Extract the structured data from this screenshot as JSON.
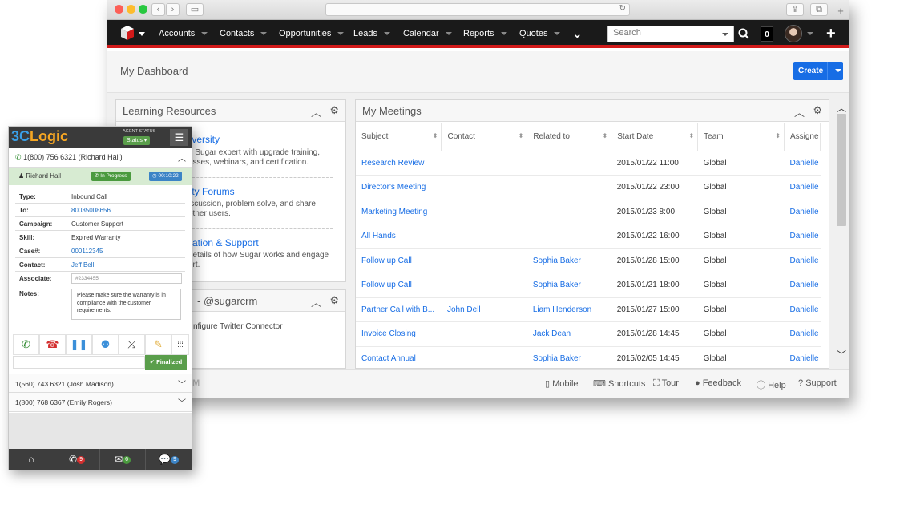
{
  "browser": {
    "controls": {
      "back": "‹",
      "forward": "›",
      "sidebar": "▭",
      "reload": "↻",
      "share": "⇪",
      "tabs": "⧉",
      "new_tab": "+"
    }
  },
  "nav": {
    "items": [
      "Accounts",
      "Contacts",
      "Opportunities",
      "Leads",
      "Calendar",
      "Reports",
      "Quotes"
    ],
    "more": "⌄",
    "search_placeholder": "Search",
    "notification_count": "0",
    "add": "+",
    "accent": "#d21a1a"
  },
  "dashboard": {
    "title": "My Dashboard",
    "create_label": "Create"
  },
  "learning": {
    "title": "Learning Resources",
    "items": [
      {
        "title": "niversity",
        "desc1": "n Sugar expert with upgrade training,",
        "desc2": "asses, webinars, and certification."
      },
      {
        "title": "nity Forums",
        "desc1": "iscussion, problem solve, and share",
        "desc2": "other users."
      },
      {
        "title": "ntation & Support",
        "desc1": "details of how Sugar works and engage",
        "desc2": "ort."
      }
    ]
  },
  "twitter": {
    "title": "- @sugarcrm",
    "text": "nfigure Twitter Connector"
  },
  "meetings": {
    "title": "My Meetings",
    "columns": [
      "Subject",
      "Contact",
      "Related to",
      "Start Date",
      "Team",
      "Assigne"
    ],
    "rows": [
      {
        "subject": "Research Review",
        "contact": "",
        "related": "",
        "start": "2015/01/22 11:00",
        "team": "Global",
        "assigned": "Danielle"
      },
      {
        "subject": "Director's Meeting",
        "contact": "",
        "related": "",
        "start": "2015/01/22 23:00",
        "team": "Global",
        "assigned": "Danielle"
      },
      {
        "subject": "Marketing Meeting",
        "contact": "",
        "related": "",
        "start": "2015/01/23 8:00",
        "team": "Global",
        "assigned": "Danielle"
      },
      {
        "subject": "All Hands",
        "contact": "",
        "related": "",
        "start": "2015/01/22 16:00",
        "team": "Global",
        "assigned": "Danielle"
      },
      {
        "subject": "Follow up Call",
        "contact": "",
        "related": "Sophia Baker",
        "start": "2015/01/28 15:00",
        "team": "Global",
        "assigned": "Danielle"
      },
      {
        "subject": "Follow up Call",
        "contact": "",
        "related": "Sophia Baker",
        "start": "2015/01/21 18:00",
        "team": "Global",
        "assigned": "Danielle"
      },
      {
        "subject": "Partner Call with B...",
        "contact": "John Dell",
        "related": "Liam Henderson",
        "start": "2015/01/27 15:00",
        "team": "Global",
        "assigned": "Danielle"
      },
      {
        "subject": "Invoice Closing",
        "contact": "",
        "related": "Jack Dean",
        "start": "2015/01/28 14:45",
        "team": "Global",
        "assigned": "Danielle"
      },
      {
        "subject": "Contact Annual",
        "contact": "",
        "related": "Sophia Baker",
        "start": "2015/02/05 14:45",
        "team": "Global",
        "assigned": "Danielle"
      }
    ]
  },
  "footer": {
    "brand": "M",
    "links": [
      "Mobile",
      "Shortcuts",
      "Tour",
      "Feedback",
      "Help",
      "Support"
    ]
  },
  "widget": {
    "logo_prefix": "3C",
    "logo_suffix": "Logic",
    "agent_status_label": "AGENT STATUS",
    "status_value": "Status",
    "active_call": "1(800) 756 6321 (Richard Hall)",
    "caller_name": "Richard Hall",
    "call_state": "In Progress",
    "timer": "00:10:22",
    "fields": [
      {
        "key": "Type:",
        "value": "Inbound Call"
      },
      {
        "key": "To:",
        "value": "80035008656"
      },
      {
        "key": "Campaign:",
        "value": "Customer Support"
      },
      {
        "key": "Skill:",
        "value": "Expired Warranty"
      },
      {
        "key": "Case#:",
        "value": "000112345"
      },
      {
        "key": "Contact:",
        "value": "Jeff Bell"
      }
    ],
    "associate_label": "Associate:",
    "associate_value": "#2334455",
    "notes_label": "Notes:",
    "notes_value": "Please make sure the warranty is in compliance with the customer requirements.",
    "finalized_label": "Finalized",
    "other_calls": [
      "1(560) 743 6321 (Josh Madison)",
      "1(800) 768 6367 (Emily Rogers)"
    ],
    "calls_badge": "9",
    "messages_badge": "6",
    "chats_badge": "9"
  }
}
